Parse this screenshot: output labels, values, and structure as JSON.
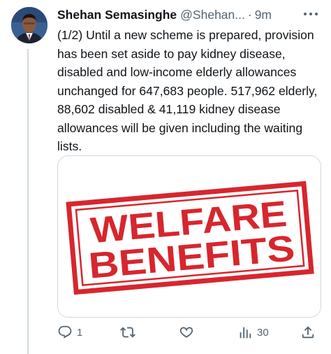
{
  "tweet": {
    "author_name": "Shehan Semasinghe",
    "handle": "@Shehan...",
    "separator": "·",
    "time": "9m",
    "text": "(1/2) Until a new scheme is prepared, provision has been set aside to pay kidney disease, disabled and low-income elderly allowances unchanged for 647,683 people. 517,962 elderly, 88,602 disabled & 41,119 kidney disease allowances will be given including the waiting lists.",
    "image": {
      "stamp_line1": "WELFARE",
      "stamp_line2": "BENEFITS",
      "stamp_color": "#d7262e"
    }
  },
  "actions": {
    "reply_count": "1",
    "retweet_count": "",
    "like_count": "",
    "views_count": "30"
  },
  "icons": {
    "more": "more-horizontal-icon",
    "reply": "reply-icon",
    "retweet": "retweet-icon",
    "like": "heart-icon",
    "views": "views-chart-icon",
    "share": "share-icon"
  },
  "colors": {
    "secondary_text": "#536471",
    "border": "#cfd9de"
  }
}
